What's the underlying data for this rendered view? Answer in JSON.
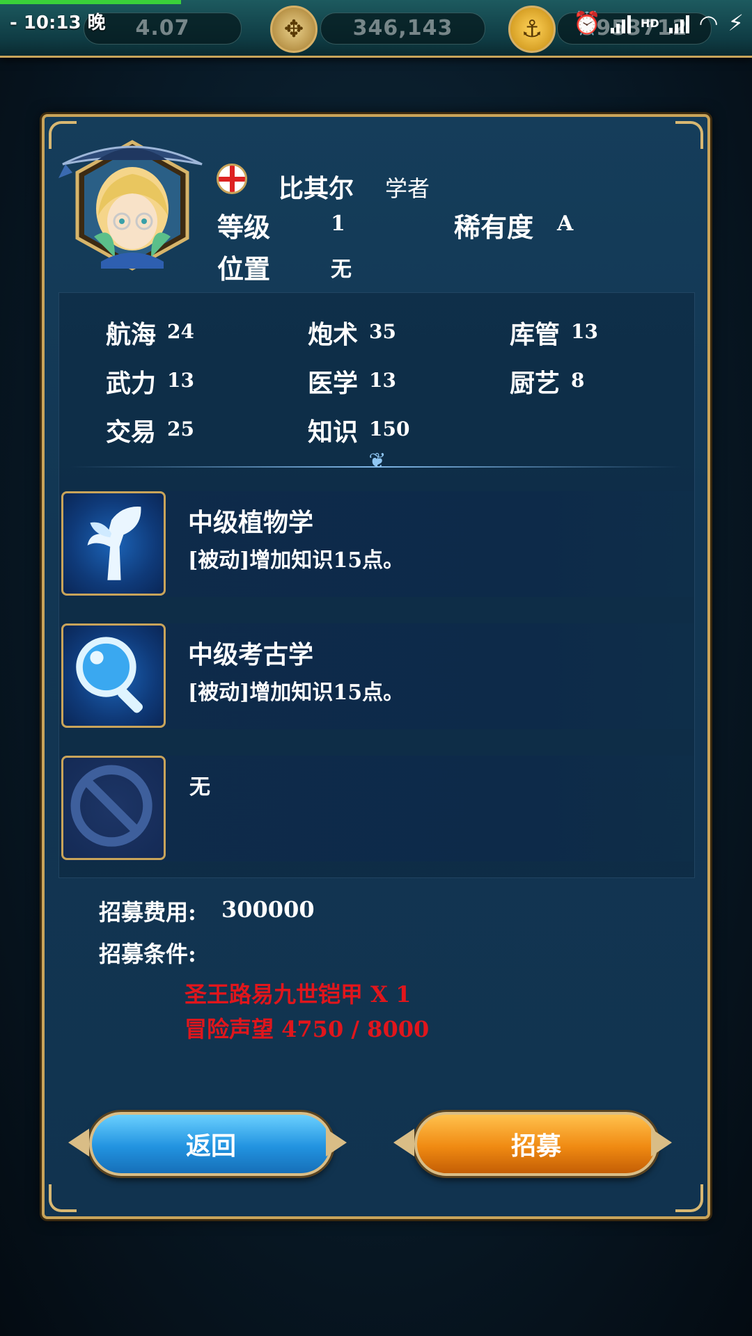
{
  "status_bar": {
    "time": "10:13",
    "period": "晚",
    "left_value": "4.07",
    "center_value": "346,143",
    "right_value": "9953712",
    "network": "HD"
  },
  "character": {
    "name": "比其尔",
    "job": "学者",
    "level_label": "等级",
    "level_value": "1",
    "rarity_label": "稀有度",
    "rarity_value": "A",
    "position_label": "位置",
    "position_value": "无"
  },
  "attributes": [
    {
      "name": "航海",
      "value": "24"
    },
    {
      "name": "炮术",
      "value": "35"
    },
    {
      "name": "库管",
      "value": "13"
    },
    {
      "name": "武力",
      "value": "13"
    },
    {
      "name": "医学",
      "value": "13"
    },
    {
      "name": "厨艺",
      "value": "8"
    },
    {
      "name": "交易",
      "value": "25"
    },
    {
      "name": "知识",
      "value": "150"
    }
  ],
  "skills": [
    {
      "title": "中级植物学",
      "desc": "[被动]增加知识15点。",
      "icon": "sprout-icon"
    },
    {
      "title": "中级考古学",
      "desc": "[被动]增加知识15点。",
      "icon": "magnifier-icon"
    },
    {
      "title": "无",
      "desc": "",
      "icon": "forbidden-icon"
    }
  ],
  "recruit": {
    "cost_label": "招募费用:",
    "cost_value": "300000",
    "condition_label": "招募条件:",
    "conditions": [
      "圣王路易九世铠甲 X 1",
      "冒险声望 4750 / 8000"
    ]
  },
  "buttons": {
    "back": "返回",
    "recruit": "招募"
  },
  "colors": {
    "panel_border": "#c9a45a",
    "panel_bg": "#133a57",
    "condition_text": "#e0161c",
    "back_button": "#2293e0",
    "recruit_button": "#f08a12"
  }
}
